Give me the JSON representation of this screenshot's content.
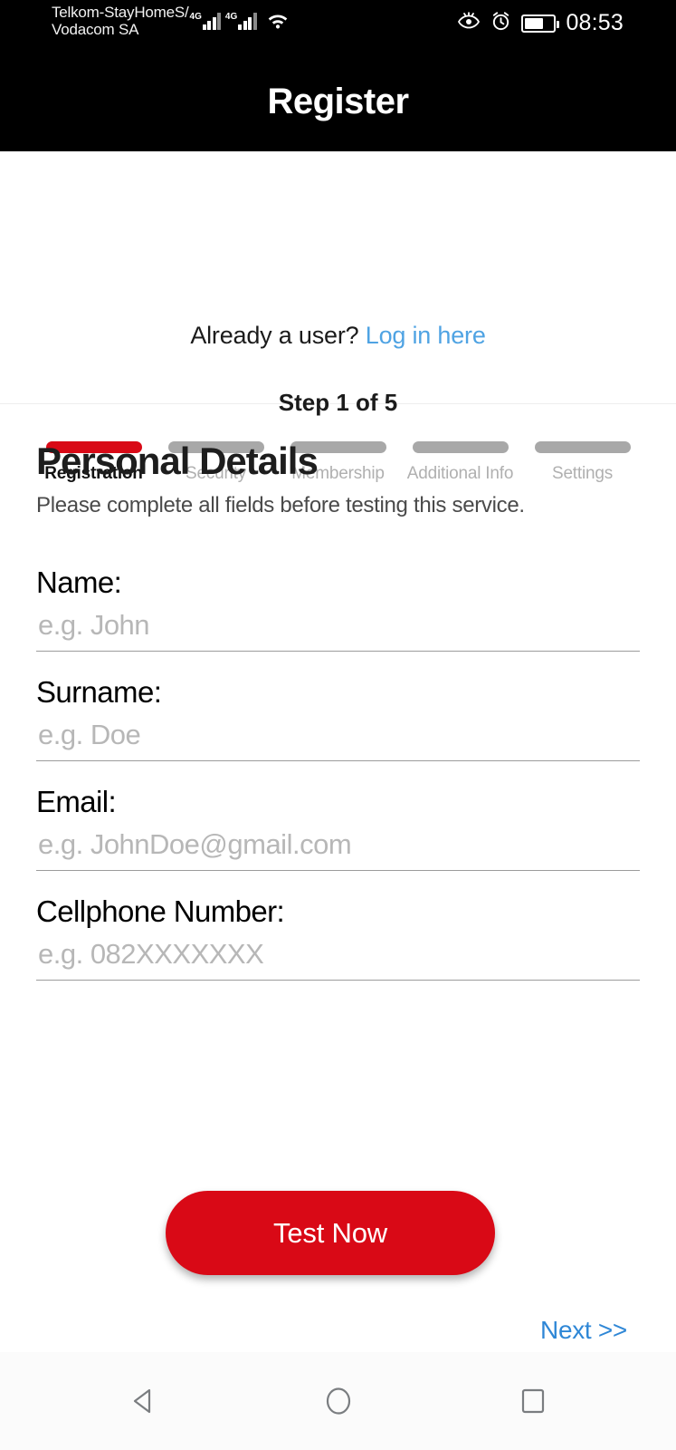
{
  "statusbar": {
    "carrier_primary": "Telkom-StayHomeS/",
    "carrier_secondary": "Vodacom SA",
    "network_1": "4G",
    "network_2": "4G",
    "clock": "08:53",
    "icons": [
      "eye-comfort-icon",
      "alarm-icon",
      "battery-icon",
      "wifi-icon",
      "signal-icon"
    ]
  },
  "titlebar": {
    "title": "Register"
  },
  "header": {
    "already_prefix": "Already a user? ",
    "login_link": "Log in here",
    "step_text": "Step 1 of 5"
  },
  "steps": [
    {
      "label": "Registration",
      "active": true
    },
    {
      "label": "Security",
      "active": false
    },
    {
      "label": "Membership",
      "active": false
    },
    {
      "label": "Additional Info",
      "active": false
    },
    {
      "label": "Settings",
      "active": false
    }
  ],
  "form": {
    "section_title": "Personal Details",
    "section_subtitle": "Please complete all fields before testing this service.",
    "fields": [
      {
        "label": "Name:",
        "placeholder": "e.g. John",
        "value": ""
      },
      {
        "label": "Surname:",
        "placeholder": "e.g. Doe",
        "value": ""
      },
      {
        "label": "Email:",
        "placeholder": "e.g. JohnDoe@gmail.com",
        "value": ""
      },
      {
        "label": "Cellphone Number:",
        "placeholder": "e.g. 082XXXXXXX",
        "value": ""
      }
    ]
  },
  "actions": {
    "test_button": "Test Now",
    "next_link": "Next >>"
  },
  "navbar": {
    "back": "back-triangle-icon",
    "home": "home-circle-icon",
    "recents": "recents-square-icon"
  },
  "colors": {
    "accent_red": "#d90916",
    "link_blue": "#4fa3e3",
    "next_blue": "#2f87d6",
    "inactive_gray": "#a8a8a8",
    "bar_black": "#000000"
  }
}
